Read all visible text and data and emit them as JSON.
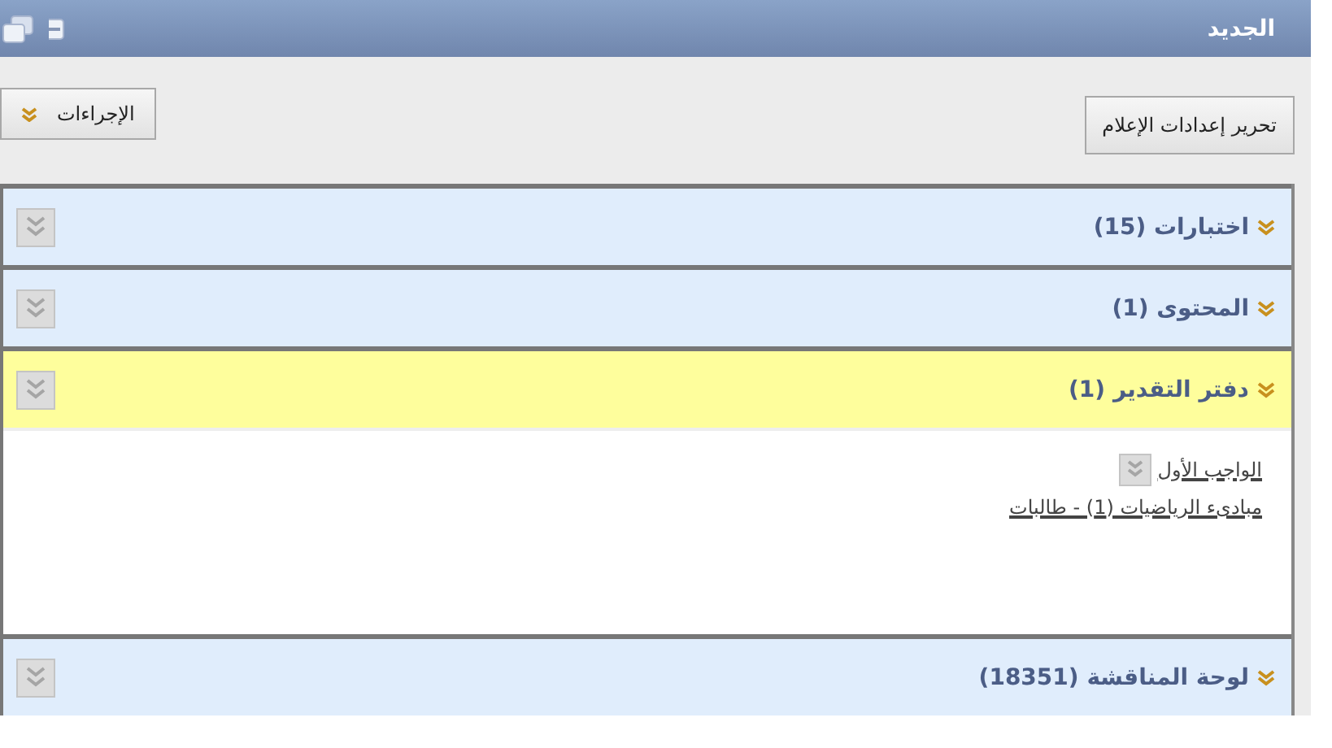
{
  "header": {
    "title": "الجديد"
  },
  "toolbar": {
    "edit_button": "تحرير إعدادات الإعلام",
    "actions_button": "الإجراءات"
  },
  "sections": [
    {
      "title": "اختبارات",
      "count": "(15)",
      "highlighted": false
    },
    {
      "title": "المحتوى",
      "count": "(1)",
      "highlighted": false
    },
    {
      "title": "دفتر التقدير",
      "count": "(1)",
      "highlighted": true,
      "items": [
        {
          "title": "الواجب الأول",
          "subtitle": "مبادىء الرياضيات (1) - طالبات"
        }
      ]
    },
    {
      "title": "لوحة المناقشة",
      "count": "(18351)",
      "highlighted": false
    }
  ]
}
